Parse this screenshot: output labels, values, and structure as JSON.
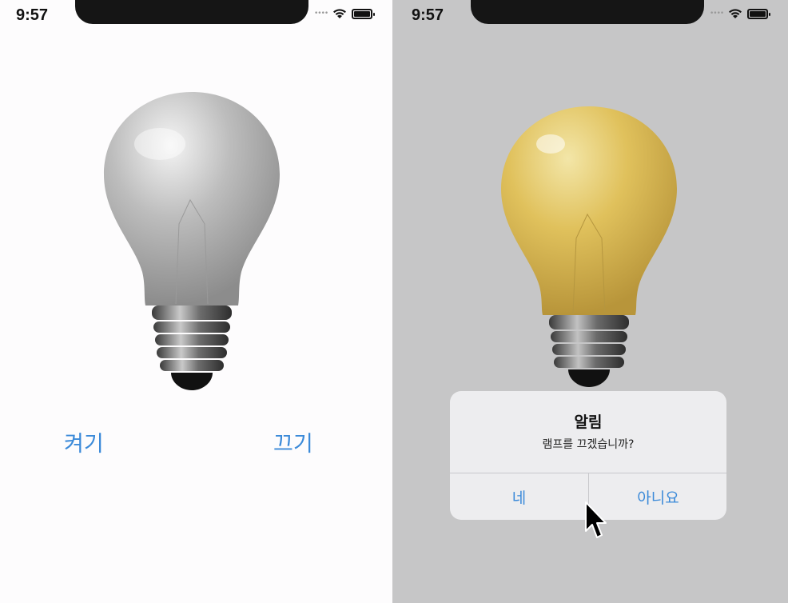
{
  "left_screen": {
    "status_time": "9:57",
    "icons": [
      "signal-icon",
      "wifi-icon",
      "battery-icon"
    ],
    "bulb": {
      "state": "off",
      "color": "#a9a9a9"
    },
    "buttons": {
      "on_label": "켜기",
      "off_label": "끄기"
    }
  },
  "right_screen": {
    "status_time": "9:57",
    "icons": [
      "signal-icon",
      "wifi-icon",
      "battery-icon"
    ],
    "bulb": {
      "state": "on",
      "color": "#e3c25d"
    },
    "alert": {
      "title": "알림",
      "message": "램프를 끄겠습니까?",
      "yes_label": "네",
      "no_label": "아니요"
    },
    "cursor": "arrow-cursor-icon"
  },
  "colors": {
    "accent": "#3b8ad9",
    "dim_background": "#c6c6c7",
    "screen_background": "#fdfcfd"
  }
}
